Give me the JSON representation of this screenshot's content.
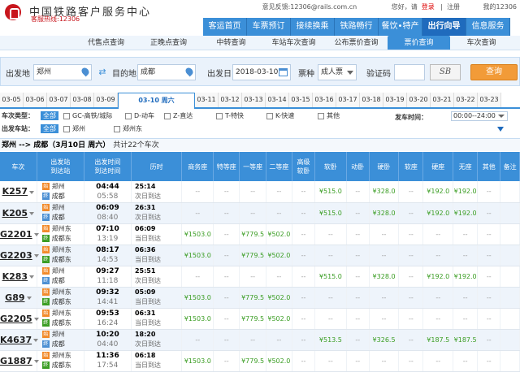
{
  "header": {
    "title": "中国铁路客户服务中心",
    "hotline": "客服热线:12306"
  },
  "toplinks": {
    "feedback": "意见反馈:",
    "email": "12306@rails.com.cn",
    "welcome": "您好，请",
    "login": "登录",
    "register": "注册",
    "my12306": "我的12306"
  },
  "nav": [
    "客运首页",
    "车票预订",
    "接续换乘",
    "铁路畅行",
    "餐饮•特产",
    "出行向导",
    "信息服务"
  ],
  "nav_active": 5,
  "subnav": [
    "代售点查询",
    "正晚点查询",
    "中转查询",
    "车站车次查询",
    "公布票价查询",
    "票价查询",
    "车次查询"
  ],
  "subnav_active": 5,
  "search": {
    "from_label": "出发地",
    "from": "郑州",
    "to_label": "目的地",
    "to": "成都",
    "date_label": "出发日",
    "date": "2018-03-10",
    "type_label": "票种",
    "type": "成人票",
    "code_label": "验证码",
    "captcha": "SB",
    "query": "查询"
  },
  "dates": [
    "03-05",
    "03-06",
    "03-07",
    "03-08",
    "03-09",
    "03-10 周六",
    "03-11",
    "03-12",
    "03-13",
    "03-14",
    "03-15",
    "03-16",
    "03-17",
    "03-18",
    "03-19",
    "03-20",
    "03-21",
    "03-22",
    "03-23"
  ],
  "date_active": 5,
  "filters": {
    "type_label": "车次类型：",
    "from_label": "出发车站：",
    "all": "全部",
    "types": [
      "GC-高铁/城际",
      "D-动车",
      "Z-直达",
      "T-特快",
      "K-快速",
      "其他"
    ],
    "stations": [
      "郑州",
      "郑州东"
    ],
    "dep_time_label": "发车时间：",
    "dep_time": "00:00--24:00"
  },
  "route": {
    "text": "郑州 --> 成都（3月10日  周六）",
    "count": "共计22个车次"
  },
  "columns": [
    "车次",
    "出发站\n到达站",
    "出发时间\n到达时间",
    "历时",
    "商务座",
    "特等座",
    "一等座",
    "二等座",
    "高级\n软卧",
    "软卧",
    "动卧",
    "硬卧",
    "软座",
    "硬座",
    "无座",
    "其他",
    "备注"
  ],
  "rows": [
    {
      "no": "K257",
      "from": "郑州",
      "to": "成都",
      "fb": "s",
      "tb": "p",
      "dep": "04:44",
      "arr": "05:58",
      "dur": "25:14",
      "day": "次日到达",
      "p": [
        "--",
        "--",
        "--",
        "--",
        "--",
        "¥515.0",
        "--",
        "¥328.0",
        "--",
        "¥192.0",
        "¥192.0",
        "--",
        ""
      ]
    },
    {
      "no": "K205",
      "from": "郑州",
      "to": "成都",
      "fb": "s",
      "tb": "p",
      "dep": "06:09",
      "arr": "08:40",
      "dur": "26:31",
      "day": "次日到达",
      "p": [
        "--",
        "--",
        "--",
        "--",
        "--",
        "¥515.0",
        "--",
        "¥328.0",
        "--",
        "¥192.0",
        "¥192.0",
        "--",
        ""
      ]
    },
    {
      "no": "G2201",
      "from": "郑州东",
      "to": "成都东",
      "fb": "s",
      "tb": "g",
      "dep": "07:10",
      "arr": "13:19",
      "dur": "06:09",
      "day": "当日到达",
      "p": [
        "¥1503.0",
        "--",
        "¥779.5",
        "¥502.0",
        "--",
        "--",
        "--",
        "--",
        "--",
        "--",
        "--",
        "--",
        ""
      ]
    },
    {
      "no": "G2203",
      "from": "郑州东",
      "to": "成都东",
      "fb": "s",
      "tb": "g",
      "dep": "08:17",
      "arr": "14:53",
      "dur": "06:36",
      "day": "当日到达",
      "p": [
        "¥1503.0",
        "--",
        "¥779.5",
        "¥502.0",
        "--",
        "--",
        "--",
        "--",
        "--",
        "--",
        "--",
        "--",
        ""
      ]
    },
    {
      "no": "K283",
      "from": "郑州",
      "to": "成都",
      "fb": "s",
      "tb": "p",
      "dep": "09:27",
      "arr": "11:18",
      "dur": "25:51",
      "day": "次日到达",
      "p": [
        "--",
        "--",
        "--",
        "--",
        "--",
        "¥515.0",
        "--",
        "¥328.0",
        "--",
        "¥192.0",
        "¥192.0",
        "--",
        ""
      ]
    },
    {
      "no": "G89",
      "from": "郑州东",
      "to": "成都东",
      "fb": "s",
      "tb": "g",
      "dep": "09:32",
      "arr": "14:41",
      "dur": "05:09",
      "day": "当日到达",
      "p": [
        "¥1503.0",
        "--",
        "¥779.5",
        "¥502.0",
        "--",
        "--",
        "--",
        "--",
        "--",
        "--",
        "--",
        "--",
        ""
      ]
    },
    {
      "no": "G2205",
      "from": "郑州东",
      "to": "成都东",
      "fb": "s",
      "tb": "g",
      "dep": "09:53",
      "arr": "16:24",
      "dur": "06:31",
      "day": "当日到达",
      "p": [
        "¥1503.0",
        "--",
        "¥779.5",
        "¥502.0",
        "--",
        "--",
        "--",
        "--",
        "--",
        "--",
        "--",
        "--",
        ""
      ]
    },
    {
      "no": "K4637",
      "from": "郑州",
      "to": "成都",
      "fb": "s",
      "tb": "p",
      "dep": "10:20",
      "arr": "04:40",
      "dur": "18:20",
      "day": "次日到达",
      "p": [
        "--",
        "--",
        "--",
        "--",
        "--",
        "¥513.5",
        "--",
        "¥326.5",
        "--",
        "¥187.5",
        "¥187.5",
        "--",
        ""
      ]
    },
    {
      "no": "G1887",
      "from": "郑州东",
      "to": "成都东",
      "fb": "s",
      "tb": "g",
      "dep": "11:36",
      "arr": "17:54",
      "dur": "06:18",
      "day": "当日到达",
      "p": [
        "¥1503.0",
        "--",
        "¥779.5",
        "¥502.0",
        "--",
        "--",
        "--",
        "--",
        "--",
        "--",
        "--",
        "--",
        ""
      ]
    }
  ]
}
